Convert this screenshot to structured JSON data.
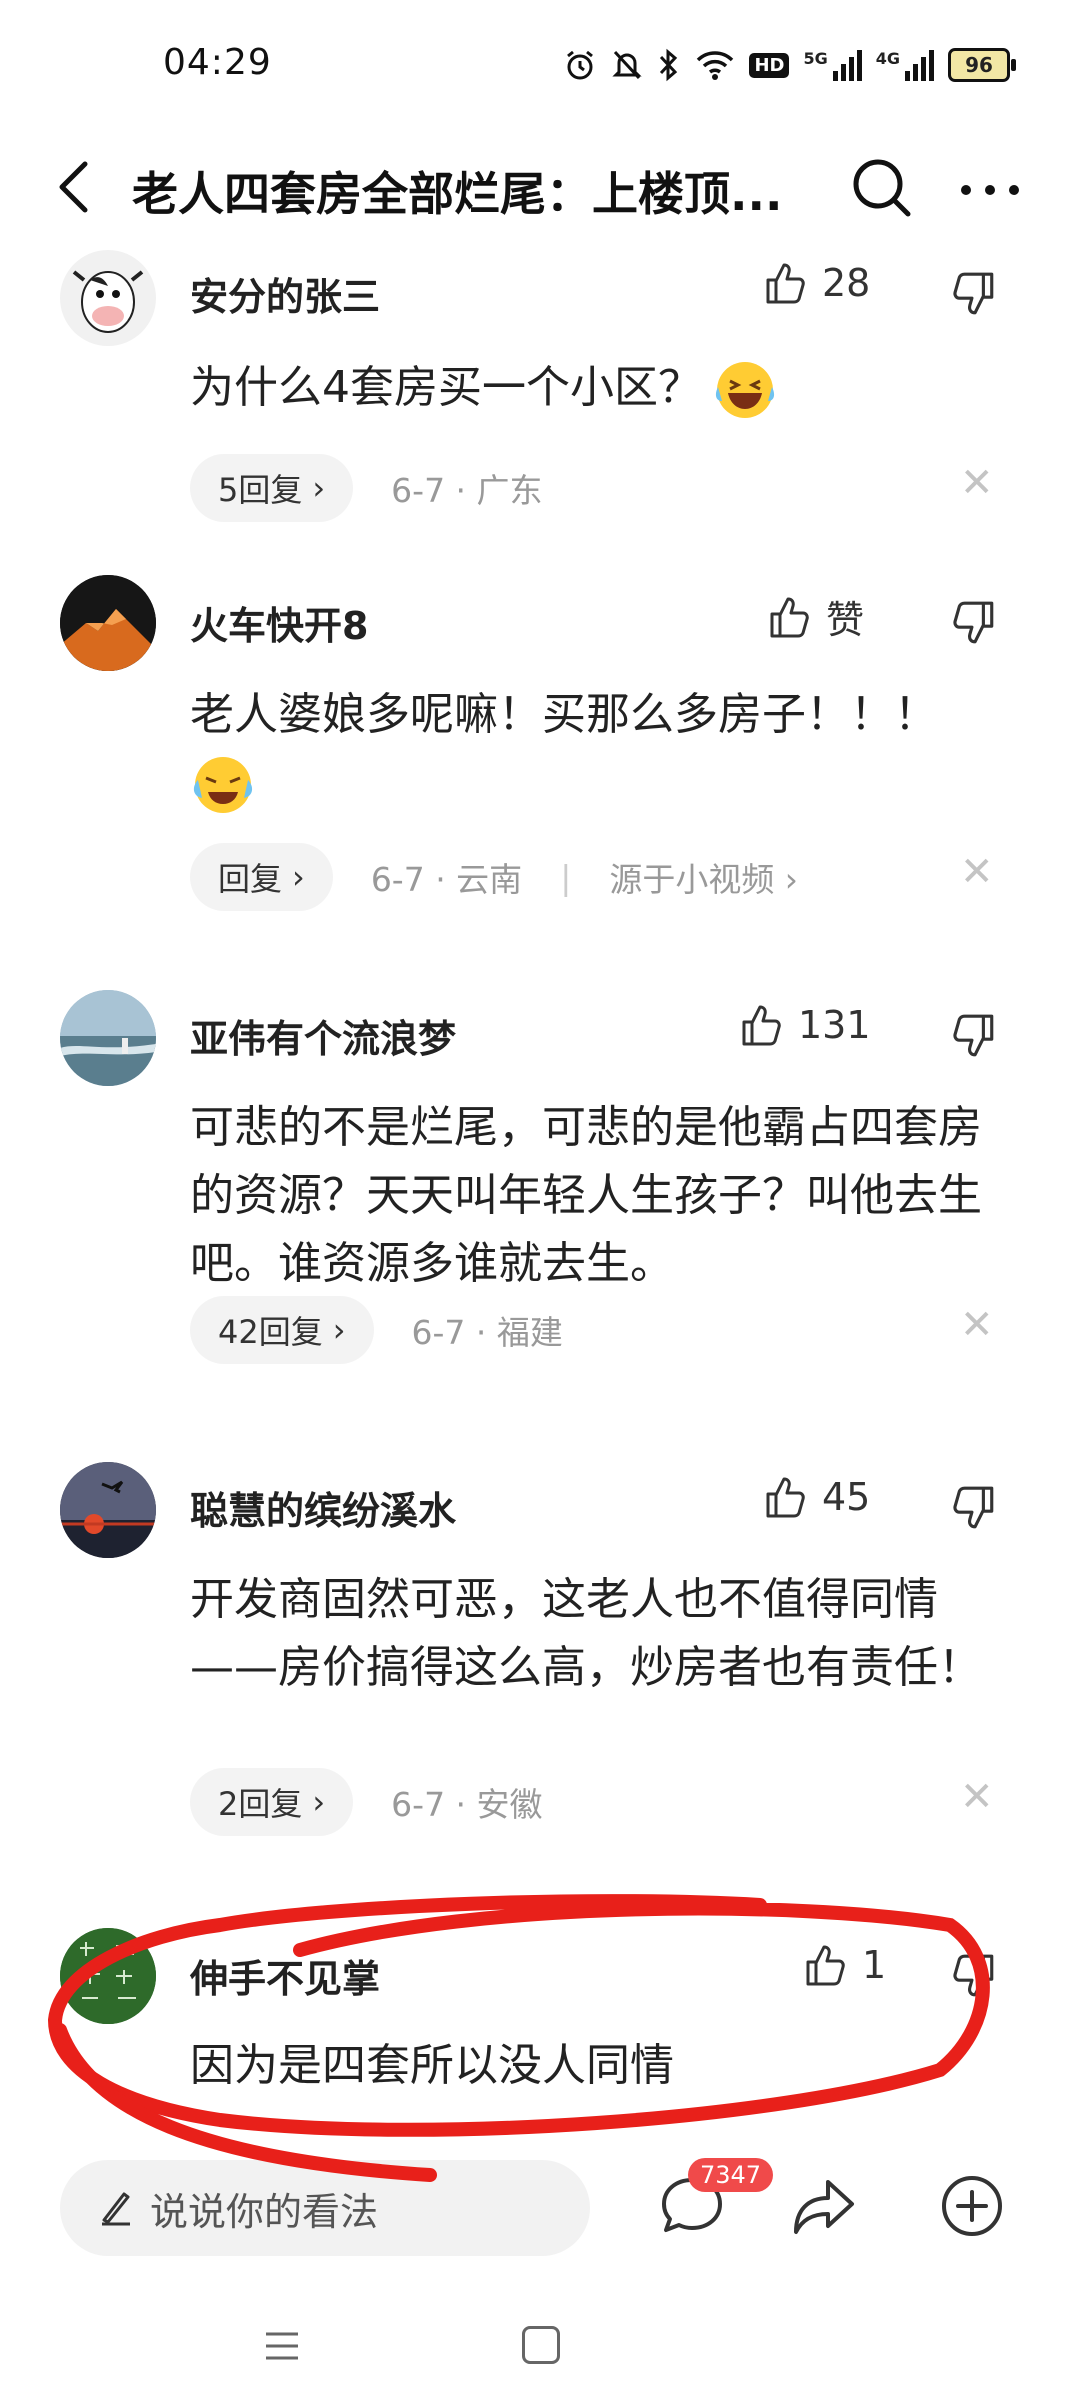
{
  "status_bar": {
    "time": "04:29",
    "signal_labels": [
      "5G",
      "4G"
    ],
    "hd_label": "HD",
    "battery": "96"
  },
  "header": {
    "title": "老人四套房全部烂尾：上楼顶..."
  },
  "comments": [
    {
      "username": "安分的张三",
      "likes": "28",
      "text": "为什么4套房买一个小区？",
      "replies": "5回复",
      "meta": "6-7 · 广东",
      "source": ""
    },
    {
      "username": "火车快开8",
      "likes": "赞",
      "text": "老人婆娘多呢嘛！买那么多房子！！！",
      "replies": "回复",
      "meta": "6-7 · 云南",
      "source": "源于小视频"
    },
    {
      "username": "亚伟有个流浪梦",
      "likes": "131",
      "text": "可悲的不是烂尾，可悲的是他霸占四套房的资源？天天叫年轻人生孩子？叫他去生吧。谁资源多谁就去生。",
      "replies": "42回复",
      "meta": "6-7 · 福建",
      "source": ""
    },
    {
      "username": "聪慧的缤纷溪水",
      "likes": "45",
      "text": "开发商固然可恶，这老人也不值得同情——房价搞得这么高，炒房者也有责任！",
      "replies": "2回复",
      "meta": "6-7 · 安徽",
      "source": ""
    },
    {
      "username": "伸手不见掌",
      "likes": "1",
      "text": "因为是四套所以没人同情"
    }
  ],
  "bottom_bar": {
    "input_placeholder": "说说你的看法",
    "comment_count": "7347"
  },
  "colors": {
    "annotation": "#e8201a",
    "badge": "#f04a4a"
  }
}
